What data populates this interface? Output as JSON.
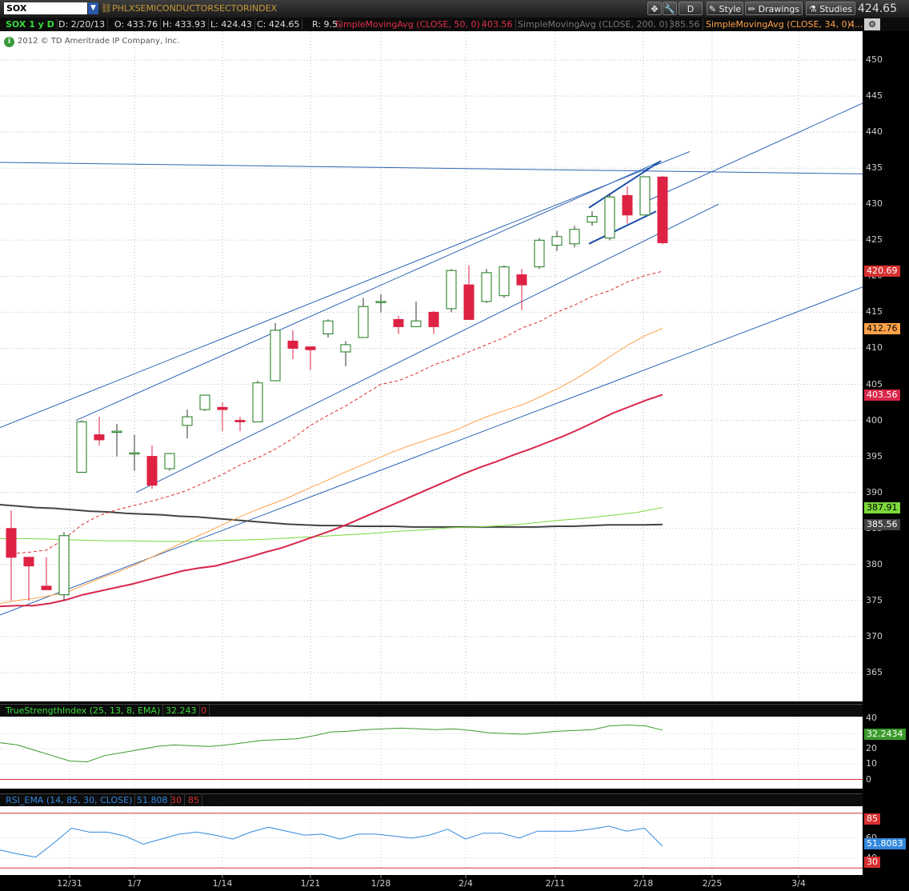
{
  "toolbar": {
    "symbol": "SOX",
    "description": "PHLXSEMICONDUCTORSECTORINDEX",
    "d_button": "D",
    "style_label": "Style",
    "drawings_label": "Drawings",
    "studies_label": "Studies",
    "last_price": "424.65"
  },
  "infobar": {
    "period": "SOX 1 y D",
    "date": "D: 2/20/13",
    "open": "O: 433.76",
    "high": "H: 433.93",
    "low": "L: 424.43",
    "close": "C: 424.65",
    "range": "R: 9.5",
    "sma50_label": "SimpleMovingAvg (CLOSE, 50, 0)",
    "sma50_value": "403.56",
    "sma200_label": "SimpleMovingAvg (CLOSE, 200, 0)",
    "sma200_value": "385.56",
    "sma34_label": "SimpleMovingAvg (CLOSE, 34, 0)",
    "sma34_value": "4..."
  },
  "copyright": "2012 © TD Ameritrade IP Company, Inc.",
  "colors": {
    "up_candle": "#ffffff",
    "up_candle_border": "#1a7a1a",
    "down_candle": "#dd2244",
    "sma50": "#d8274a",
    "sma200": "#444444",
    "sma34": "#ffa24a",
    "ema_dashed": "#d83030",
    "green_ma": "#7ad83a",
    "trendline": "#2e64b4",
    "tsi": "#3a9a2a",
    "rsi": "#3388dd",
    "rsi_band": "#d83030"
  },
  "price_badges": {
    "ema_dashed": "420.69",
    "sma34": "412.76",
    "sma50": "403.56",
    "green_ma": "387.91",
    "sma200": "385.56"
  },
  "tsi": {
    "title": "TrueStrengthIndex (25, 13, 8, EMA)",
    "value": "32.243",
    "zero": "0",
    "badge": "32.2434",
    "ticks": [
      "40",
      "30",
      "20",
      "10",
      "0"
    ]
  },
  "rsi": {
    "title": "RSI_EMA (14, 85, 30, CLOSE)",
    "value": "51.808",
    "lower": "30",
    "upper": "85",
    "badge": "51.8083",
    "badge_upper": "85",
    "badge_lower": "30",
    "ticks": [
      "60",
      "40"
    ]
  },
  "chart_data": {
    "type": "candlestick",
    "ylim": [
      361,
      454
    ],
    "yticks": [
      365,
      370,
      375,
      380,
      385,
      390,
      395,
      400,
      405,
      410,
      415,
      420,
      425,
      430,
      435,
      440,
      445,
      450
    ],
    "x_tick_labels": [
      "12/31",
      "1/7",
      "1/14",
      "1/21",
      "1/28",
      "2/4",
      "2/11",
      "2/18",
      "2/25",
      "3/4"
    ],
    "candles": [
      {
        "o": 385,
        "h": 387.5,
        "l": 375,
        "c": 381
      },
      {
        "o": 381,
        "h": 381,
        "l": 375,
        "c": 379.8
      },
      {
        "o": 377,
        "h": 381,
        "l": 376.5,
        "c": 376.5
      },
      {
        "o": 375.8,
        "h": 384.5,
        "l": 375,
        "c": 384
      },
      {
        "o": 392.8,
        "h": 400,
        "l": 392.8,
        "c": 399.8
      },
      {
        "o": 398,
        "h": 400.5,
        "l": 396.5,
        "c": 397.3
      },
      {
        "o": 398.5,
        "h": 399.5,
        "l": 395,
        "c": 398.5
      },
      {
        "o": 395.5,
        "h": 398,
        "l": 393,
        "c": 395.5
      },
      {
        "o": 395,
        "h": 396.5,
        "l": 390.5,
        "c": 391
      },
      {
        "o": 393.3,
        "h": 395.5,
        "l": 393,
        "c": 395.4
      },
      {
        "o": 399.3,
        "h": 401.5,
        "l": 397.5,
        "c": 400.5
      },
      {
        "o": 401.5,
        "h": 403.5,
        "l": 401.3,
        "c": 403.5
      },
      {
        "o": 401.8,
        "h": 402.5,
        "l": 398.5,
        "c": 401.5
      },
      {
        "o": 400,
        "h": 400.5,
        "l": 398.5,
        "c": 399.8
      },
      {
        "o": 399.8,
        "h": 405.5,
        "l": 399.8,
        "c": 405.2
      },
      {
        "o": 405.5,
        "h": 413.5,
        "l": 405.5,
        "c": 412.5
      },
      {
        "o": 411,
        "h": 412.5,
        "l": 408.5,
        "c": 410
      },
      {
        "o": 410.2,
        "h": 410.2,
        "l": 407,
        "c": 409.8
      },
      {
        "o": 412,
        "h": 414,
        "l": 411.5,
        "c": 413.8
      },
      {
        "o": 409.5,
        "h": 411,
        "l": 407.5,
        "c": 410.5
      },
      {
        "o": 411.5,
        "h": 417,
        "l": 411.5,
        "c": 415.8
      },
      {
        "o": 416.5,
        "h": 417.5,
        "l": 415,
        "c": 416.5
      },
      {
        "o": 414,
        "h": 414.5,
        "l": 412,
        "c": 413
      },
      {
        "o": 413,
        "h": 416.5,
        "l": 413,
        "c": 413.8
      },
      {
        "o": 415,
        "h": 415.2,
        "l": 412,
        "c": 413
      },
      {
        "o": 415.5,
        "h": 421,
        "l": 415,
        "c": 420.8
      },
      {
        "o": 418.8,
        "h": 421.5,
        "l": 414,
        "c": 414
      },
      {
        "o": 416.5,
        "h": 421,
        "l": 416.3,
        "c": 420.5
      },
      {
        "o": 417.3,
        "h": 421.5,
        "l": 417,
        "c": 421.3
      },
      {
        "o": 420.2,
        "h": 421,
        "l": 415.3,
        "c": 418.8
      },
      {
        "o": 421.3,
        "h": 425.3,
        "l": 421,
        "c": 425
      },
      {
        "o": 424.3,
        "h": 426.3,
        "l": 423.5,
        "c": 425.5
      },
      {
        "o": 424.5,
        "h": 427,
        "l": 424,
        "c": 426.5
      },
      {
        "o": 427.5,
        "h": 429,
        "l": 427,
        "c": 428.3
      },
      {
        "o": 425.3,
        "h": 431.5,
        "l": 425,
        "c": 431
      },
      {
        "o": 431.2,
        "h": 432.5,
        "l": 427.3,
        "c": 428.5
      },
      {
        "o": 428.5,
        "h": 433.8,
        "l": 428.5,
        "c": 433.8
      },
      {
        "o": 433.76,
        "h": 433.93,
        "l": 424.43,
        "c": 424.65
      }
    ],
    "series": [
      {
        "name": "SimpleMovingAvg (CLOSE, 50, 0)",
        "values": [
          374.2,
          374.3,
          374.3,
          374.6,
          375.1,
          375.8,
          376.3,
          376.8,
          377.3,
          377.9,
          378.5,
          379.1,
          379.5,
          379.8,
          380.4,
          381.0,
          381.7,
          382.3,
          383.1,
          383.9,
          384.7,
          385.6,
          386.6,
          387.6,
          388.6,
          389.6,
          390.6,
          391.6,
          392.6,
          393.5,
          394.3,
          395.2,
          396.0,
          396.9,
          397.8,
          398.8,
          399.9,
          401.0,
          401.9,
          402.8,
          403.56
        ]
      },
      {
        "name": "SimpleMovingAvg (CLOSE, 200, 0)",
        "values": [
          388.3,
          388.1,
          387.9,
          387.8,
          387.6,
          387.4,
          387.3,
          387.1,
          387.0,
          386.9,
          386.7,
          386.6,
          386.4,
          386.2,
          386.0,
          385.8,
          385.6,
          385.5,
          385.4,
          385.4,
          385.3,
          385.3,
          385.3,
          385.2,
          385.2,
          385.2,
          385.2,
          385.2,
          385.2,
          385.2,
          385.2,
          385.3,
          385.3,
          385.4,
          385.5,
          385.5,
          385.5,
          385.56
        ]
      },
      {
        "name": "SimpleMovingAvg (CLOSE, 34, 0)",
        "values": [
          374.6,
          375.0,
          375.3,
          375.7,
          376.2,
          377.2,
          378.2,
          379.0,
          380.0,
          381.1,
          382.2,
          383.3,
          384.3,
          385.4,
          386.5,
          387.5,
          388.4,
          389.3,
          390.4,
          391.4,
          392.5,
          393.5,
          394.5,
          395.5,
          396.4,
          397.2,
          398.0,
          398.8,
          399.9,
          400.8,
          401.6,
          402.4,
          403.5,
          404.6,
          405.9,
          407.4,
          409.0,
          410.5,
          411.8,
          412.76
        ]
      },
      {
        "name": "Dashed EMA",
        "values": [
          381.5,
          381.7,
          382,
          383.5,
          385.5,
          386.8,
          387.6,
          388.2,
          388.8,
          389.5,
          390.3,
          391.4,
          392.5,
          393.8,
          394.8,
          396,
          397.5,
          399.3,
          400.7,
          402,
          403.5,
          405,
          405.5,
          406.5,
          407.7,
          408.5,
          409.5,
          410.5,
          411.5,
          412.8,
          413.7,
          415,
          416,
          417.2,
          418,
          419.2,
          420.1,
          420.69
        ]
      },
      {
        "name": "Green MA",
        "values": [
          383.6,
          383.6,
          383.5,
          383.4,
          383.3,
          383.3,
          383.2,
          383.2,
          383.3,
          383.4,
          383.5,
          383.7,
          383.9,
          384.1,
          384.3,
          384.6,
          384.8,
          385.1,
          385.2,
          385.4,
          385.7,
          386.1,
          386.4,
          386.8,
          387.2,
          387.91
        ]
      }
    ],
    "trendlines": [
      {
        "x1": 0,
        "y1": 399,
        "x2": 862,
        "y2": 437.3
      },
      {
        "x1": 0,
        "y1": 373,
        "x2": 1078,
        "y2": 418.5
      },
      {
        "x1": 0,
        "y1": 435.8,
        "x2": 1078,
        "y2": 434.2
      },
      {
        "x1": 95,
        "y1": 400,
        "x2": 826,
        "y2": 436
      },
      {
        "x1": 170,
        "y1": 390,
        "x2": 898,
        "y2": 430
      },
      {
        "x1": 810,
        "y1": 430.5,
        "x2": 1078,
        "y2": 444
      }
    ],
    "pattern": [
      {
        "x1": 736,
        "y1": 429.5,
        "x2": 826,
        "y2": 436
      },
      {
        "x1": 736,
        "y1": 424.5,
        "x2": 820,
        "y2": 429
      }
    ],
    "tsi_values": [
      24,
      22.5,
      19,
      15.5,
      12,
      11.5,
      15.5,
      17.5,
      19.5,
      21.5,
      22.5,
      22,
      21.5,
      22.5,
      24,
      25.5,
      26,
      26.5,
      28.5,
      31,
      31.5,
      32.5,
      33,
      33.5,
      33,
      32.5,
      33,
      32,
      30.5,
      30,
      29.5,
      30.5,
      31.5,
      32,
      32.5,
      35,
      35.5,
      35,
      32.2434
    ],
    "rsi_values": [
      48,
      44,
      41,
      55,
      70,
      66,
      66,
      62,
      54,
      59,
      64,
      66,
      63,
      59,
      66,
      71,
      67,
      63,
      64,
      59,
      64,
      64,
      62,
      60,
      63,
      69,
      59,
      65,
      65,
      60,
      67,
      67,
      67,
      69,
      72,
      67,
      70,
      51.8083
    ]
  }
}
